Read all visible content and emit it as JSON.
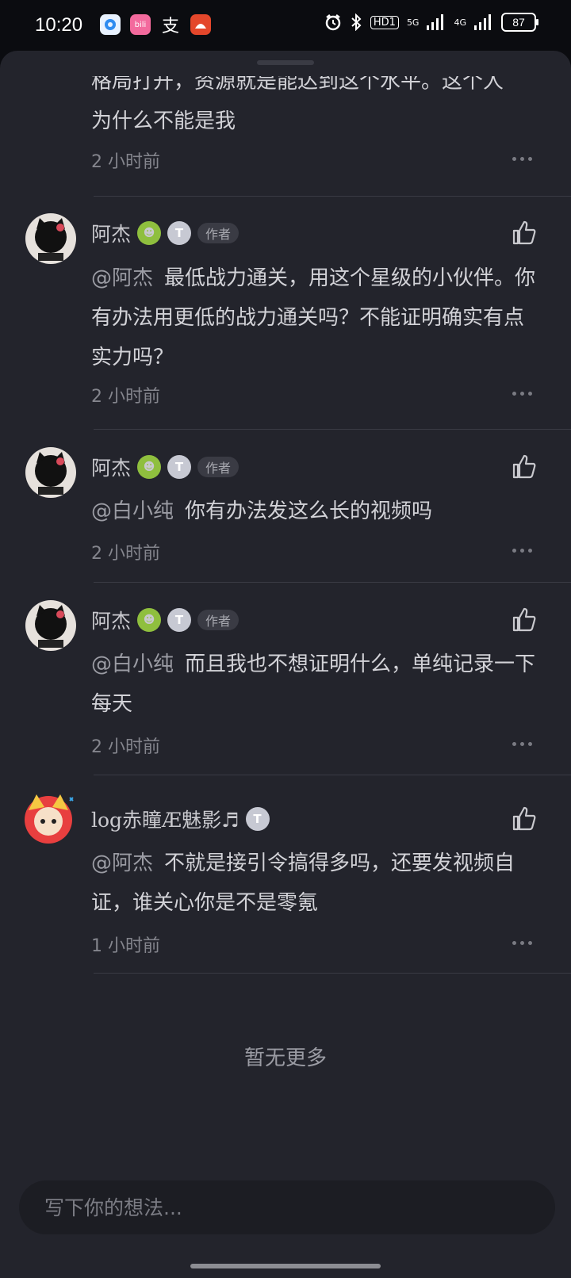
{
  "status_bar": {
    "time": "10:20",
    "app_icons": [
      "browser-app-icon",
      "bilibili-app-icon",
      "zhifubao-app-icon",
      "game-app-icon"
    ],
    "hd": "HD1",
    "net1": "5G",
    "net2": "4G",
    "battery": "87"
  },
  "colors": {
    "sheet_bg": "#23242c",
    "page_bg": "#0b0c10",
    "text": "#d2d2d7",
    "muted": "#84858d"
  },
  "partial_comment": {
    "text_line1": "格局打开，资源就是能达到这个水平。这个人",
    "text_line2": "为什么不能是我",
    "time": "2 小时前"
  },
  "comments": [
    {
      "user": "阿杰",
      "author_tag": "作者",
      "level": "T",
      "mention": "@阿杰",
      "text": "最低战力通关，用这个星级的小伙伴。你有办法用更低的战力通关吗？不能证明确实有点实力吗？",
      "time": "2 小时前"
    },
    {
      "user": "阿杰",
      "author_tag": "作者",
      "level": "T",
      "mention": "@白小纯",
      "text": "你有办法发这么长的视频吗",
      "time": "2 小时前"
    },
    {
      "user": "阿杰",
      "author_tag": "作者",
      "level": "T",
      "mention": "@白小纯",
      "text": "而且我也不想证明什么，单纯记录一下每天",
      "time": "2 小时前"
    },
    {
      "user": "log赤瞳Æ魅影♬",
      "level": "T",
      "mention": "@阿杰",
      "text": "不就是接引令搞得多吗，还要发视频自证，谁关心你是不是零氪",
      "time": "1 小时前"
    }
  ],
  "footer": {
    "no_more": "暂无更多",
    "input_placeholder": "写下你的想法..."
  }
}
